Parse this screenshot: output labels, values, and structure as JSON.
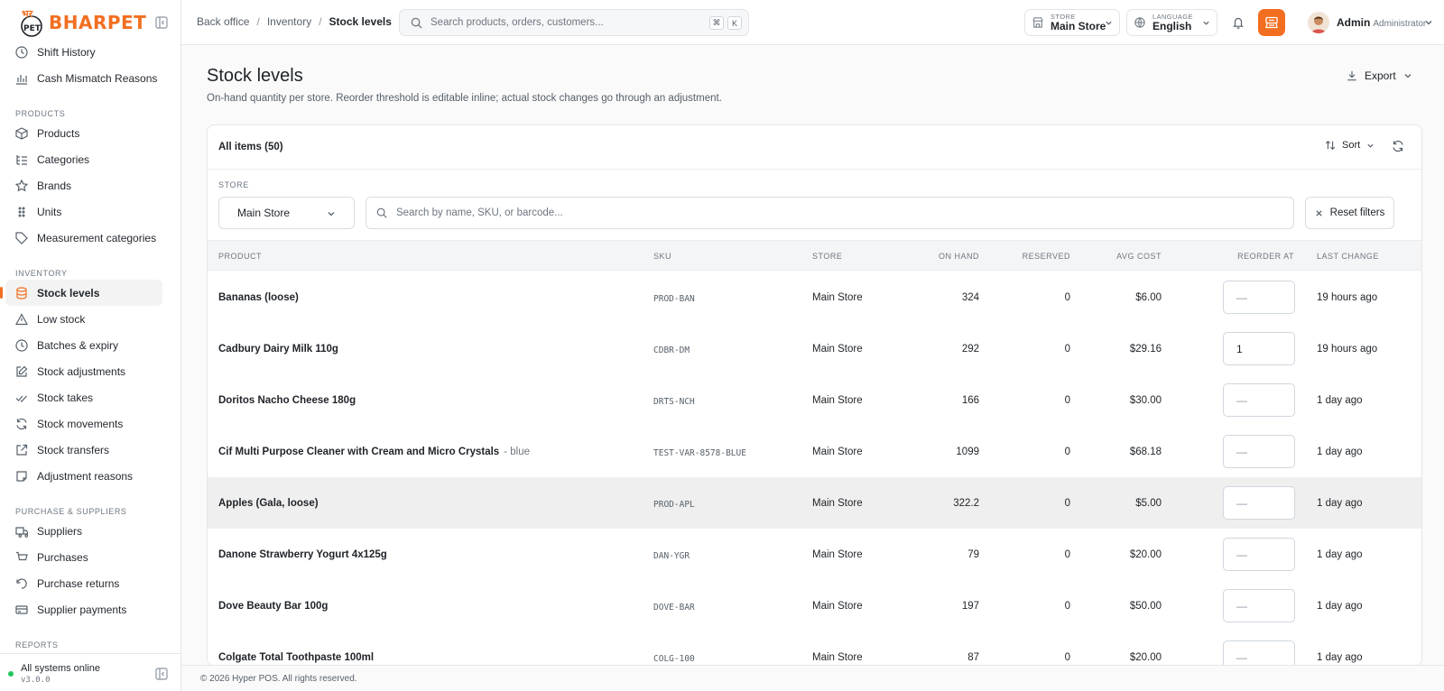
{
  "brand": {
    "name": "BHARPET",
    "mark_text": "भर PET",
    "accent": "#f26f21"
  },
  "sidebar": {
    "top_items": [
      {
        "label": "Shift History",
        "icon": "clock-icon"
      },
      {
        "label": "Cash Mismatch Reasons",
        "icon": "bar-chart-icon"
      }
    ],
    "sections": [
      {
        "title": "Products",
        "items": [
          {
            "label": "Products",
            "icon": "box-icon"
          },
          {
            "label": "Categories",
            "icon": "list-tree-icon"
          },
          {
            "label": "Brands",
            "icon": "star-icon"
          },
          {
            "label": "Units",
            "icon": "grip-icon"
          },
          {
            "label": "Measurement categories",
            "icon": "tag-icon"
          }
        ]
      },
      {
        "title": "Inventory",
        "items": [
          {
            "label": "Stock levels",
            "icon": "database-icon",
            "active": true
          },
          {
            "label": "Low stock",
            "icon": "alert-triangle-icon"
          },
          {
            "label": "Batches & expiry",
            "icon": "clock-icon"
          },
          {
            "label": "Stock adjustments",
            "icon": "edit-icon"
          },
          {
            "label": "Stock takes",
            "icon": "check-check-icon"
          },
          {
            "label": "Stock movements",
            "icon": "refresh-icon"
          },
          {
            "label": "Stock transfers",
            "icon": "external-link-icon"
          },
          {
            "label": "Adjustment reasons",
            "icon": "note-icon"
          }
        ]
      },
      {
        "title": "Purchase & Suppliers",
        "items": [
          {
            "label": "Suppliers",
            "icon": "truck-icon"
          },
          {
            "label": "Purchases",
            "icon": "cart-icon"
          },
          {
            "label": "Purchase returns",
            "icon": "undo-icon"
          },
          {
            "label": "Supplier payments",
            "icon": "credit-card-icon"
          }
        ]
      },
      {
        "title": "Reports",
        "items": []
      }
    ],
    "footer": {
      "status": "All systems online",
      "version": "v3.0.0"
    }
  },
  "topbar": {
    "breadcrumb": [
      "Back office",
      "Inventory",
      "Stock levels"
    ],
    "search_placeholder": "Search products, orders, customers...",
    "shortcut": [
      "⌘",
      "K"
    ],
    "store_label": "Store",
    "store_value": "Main Store",
    "language_label": "Language",
    "language_value": "English",
    "user_name": "Admin",
    "user_role": "Administrator"
  },
  "page": {
    "title": "Stock levels",
    "subtitle": "On-hand quantity per store. Reorder threshold is editable inline; actual stock changes go through an adjustment.",
    "export_label": "Export"
  },
  "card": {
    "all_items_label": "All items (50)",
    "sort_label": "Sort",
    "store_filter_label": "Store",
    "store_filter_value": "Main Store",
    "item_search_placeholder": "Search by name, SKU, or barcode...",
    "reset_label": "Reset filters"
  },
  "table": {
    "columns": [
      "Product",
      "SKU",
      "Store",
      "On hand",
      "Reserved",
      "Avg cost",
      "Reorder at",
      "Last change"
    ],
    "rows": [
      {
        "product": "Bananas (loose)",
        "variant": "",
        "sku": "PROD-BAN",
        "store": "Main Store",
        "on_hand": "324",
        "reserved": "0",
        "avg_cost": "$6.00",
        "reorder_at": "",
        "last_change": "19 hours ago"
      },
      {
        "product": "Cadbury Dairy Milk 110g",
        "variant": "",
        "sku": "CDBR-DM",
        "store": "Main Store",
        "on_hand": "292",
        "reserved": "0",
        "avg_cost": "$29.16",
        "reorder_at": "1",
        "last_change": "19 hours ago"
      },
      {
        "product": "Doritos Nacho Cheese 180g",
        "variant": "",
        "sku": "DRTS-NCH",
        "store": "Main Store",
        "on_hand": "166",
        "reserved": "0",
        "avg_cost": "$30.00",
        "reorder_at": "",
        "last_change": "1 day ago"
      },
      {
        "product": "Cif Multi Purpose Cleaner with Cream and Micro Crystals",
        "variant": "- blue",
        "sku": "TEST-VAR-8578-BLUE",
        "store": "Main Store",
        "on_hand": "1099",
        "reserved": "0",
        "avg_cost": "$68.18",
        "reorder_at": "",
        "last_change": "1 day ago"
      },
      {
        "product": "Apples (Gala, loose)",
        "variant": "",
        "sku": "PROD-APL",
        "store": "Main Store",
        "on_hand": "322.2",
        "reserved": "0",
        "avg_cost": "$5.00",
        "reorder_at": "",
        "last_change": "1 day ago"
      },
      {
        "product": "Danone Strawberry Yogurt 4x125g",
        "variant": "",
        "sku": "DAN-YGR",
        "store": "Main Store",
        "on_hand": "79",
        "reserved": "0",
        "avg_cost": "$20.00",
        "reorder_at": "",
        "last_change": "1 day ago"
      },
      {
        "product": "Dove Beauty Bar 100g",
        "variant": "",
        "sku": "DOVE-BAR",
        "store": "Main Store",
        "on_hand": "197",
        "reserved": "0",
        "avg_cost": "$50.00",
        "reorder_at": "",
        "last_change": "1 day ago"
      },
      {
        "product": "Colgate Total Toothpaste 100ml",
        "variant": "",
        "sku": "COLG-100",
        "store": "Main Store",
        "on_hand": "87",
        "reserved": "0",
        "avg_cost": "$20.00",
        "reorder_at": "",
        "last_change": "1 day ago"
      }
    ],
    "reorder_placeholder": "—"
  },
  "footer": {
    "copyright": "© 2026 Hyper POS. All rights reserved."
  }
}
